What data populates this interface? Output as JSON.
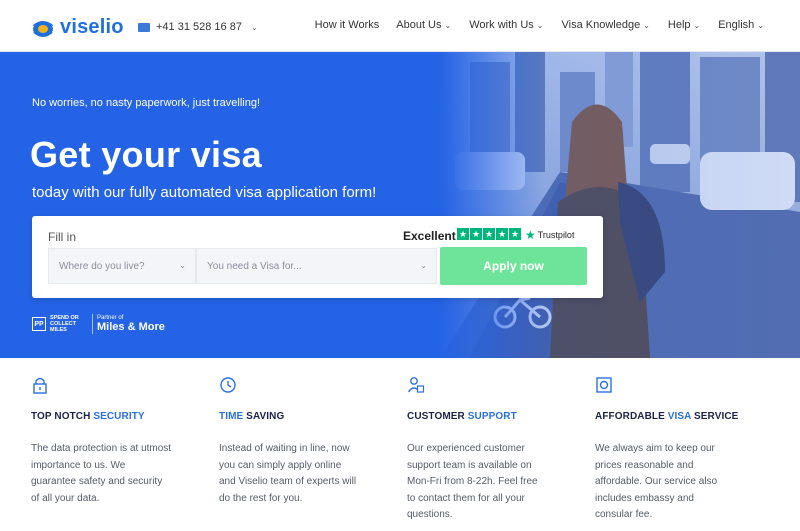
{
  "nav": {
    "logo_text": "viselio",
    "phone": "+41 31 528 16 87",
    "menu": [
      {
        "label": "How it Works",
        "has_caret": false
      },
      {
        "label": "About Us",
        "has_caret": true
      },
      {
        "label": "Work with Us",
        "has_caret": true
      },
      {
        "label": "Visa Knowledge",
        "has_caret": true
      },
      {
        "label": "Help",
        "has_caret": true
      },
      {
        "label": "English",
        "has_caret": true
      }
    ]
  },
  "hero": {
    "tagline": "No worries, no nasty paperwork, just travelling!",
    "headline": "Get your visa",
    "subhead": "today with our fully automated visa application form!",
    "form": {
      "fill_label": "Fill in",
      "rating_text": "Excellent",
      "trustpilot": "Trustpilot",
      "stars": 5,
      "select_residence_placeholder": "Where do you live?",
      "select_visa_placeholder": "You need a Visa for...",
      "apply_label": "Apply now"
    },
    "partner": {
      "pp": "PP",
      "spend_line1": "SPEND OR",
      "spend_line2": "COLLECT MILES",
      "partner_of": "Partner of",
      "brand": "Miles & More"
    }
  },
  "features": [
    {
      "title_plain": "TOP NOTCH ",
      "title_accent": "SECURITY",
      "title_tail": "",
      "icon": "lock-icon",
      "text": "The data protection is at utmost importance to us. We guarantee safety and security of all your data."
    },
    {
      "title_plain": "",
      "title_accent": "TIME",
      "title_tail": " SAVING",
      "icon": "clock-icon",
      "text": "Instead of waiting in line, now you can simply apply online and Viselio team of experts will do the rest for you."
    },
    {
      "title_plain": "CUSTOMER ",
      "title_accent": "SUPPORT",
      "title_tail": "",
      "icon": "support-icon",
      "text": "Our experienced customer support team is available on Mon-Fri from 8-22h. Feel free to contact them for all your questions."
    },
    {
      "title_plain": "AFFORDABLE ",
      "title_accent": "VISA",
      "title_tail": " SERVICE",
      "icon": "money-icon",
      "text": "We always aim to keep our prices reasonable and affordable. Our service also includes embassy and consular fee."
    }
  ],
  "colors": {
    "brand_blue": "#1f6fde",
    "hero_blue": "#2463e6",
    "apply_green": "#6ee49a",
    "trustpilot_green": "#00b67a",
    "accent_blue": "#2a6fe0"
  }
}
